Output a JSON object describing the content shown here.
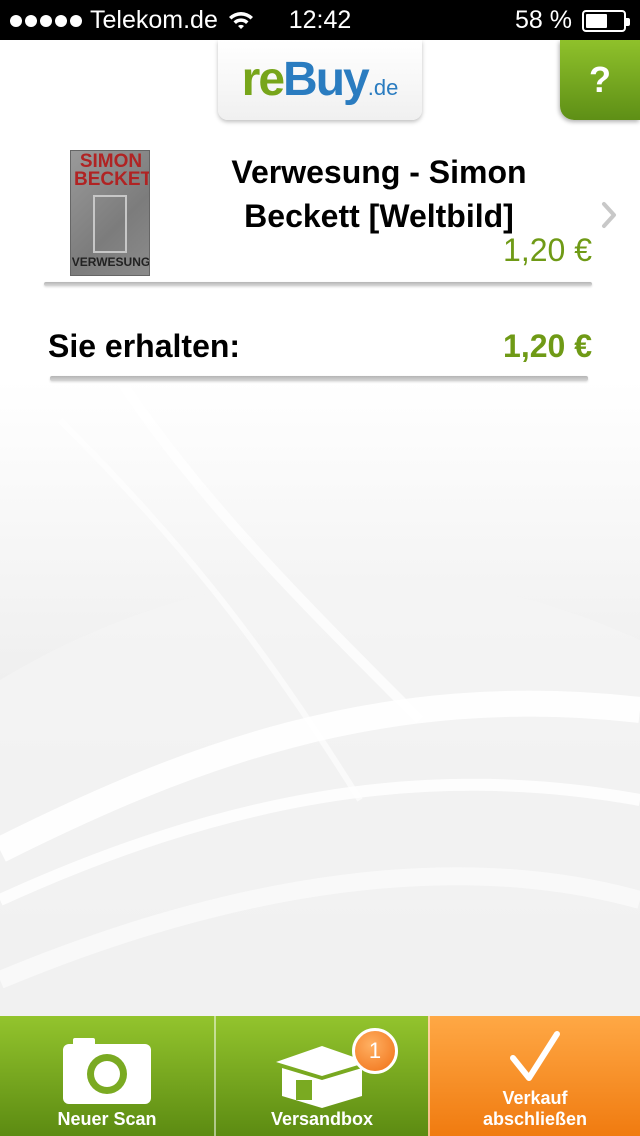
{
  "status_bar": {
    "carrier": "Telekom.de",
    "time": "12:42",
    "battery": "58 %",
    "battery_level": 0.58
  },
  "header": {
    "logo_re": "re",
    "logo_buy": "Buy",
    "logo_de": ".de",
    "help_label": "?"
  },
  "product": {
    "title": "Verwesung - Simon Beckett [Weltbild]",
    "price": "1,20 €",
    "cover": {
      "author_line1": "SIMON",
      "author_line2": "BECKETT",
      "title": "VERWESUNG"
    }
  },
  "total": {
    "label": "Sie erhalten:",
    "value": "1,20 €"
  },
  "tabs": {
    "scan": {
      "label": "Neuer Scan",
      "icon": "camera-icon"
    },
    "box": {
      "label": "Versandbox",
      "icon": "box-icon",
      "badge": "1"
    },
    "checkout": {
      "label_line1": "Verkauf",
      "label_line2": "abschließen",
      "icon": "checkmark-icon"
    }
  },
  "colors": {
    "green": "#77a51a",
    "blue": "#2a7cc0",
    "orange": "#f58a1f"
  }
}
